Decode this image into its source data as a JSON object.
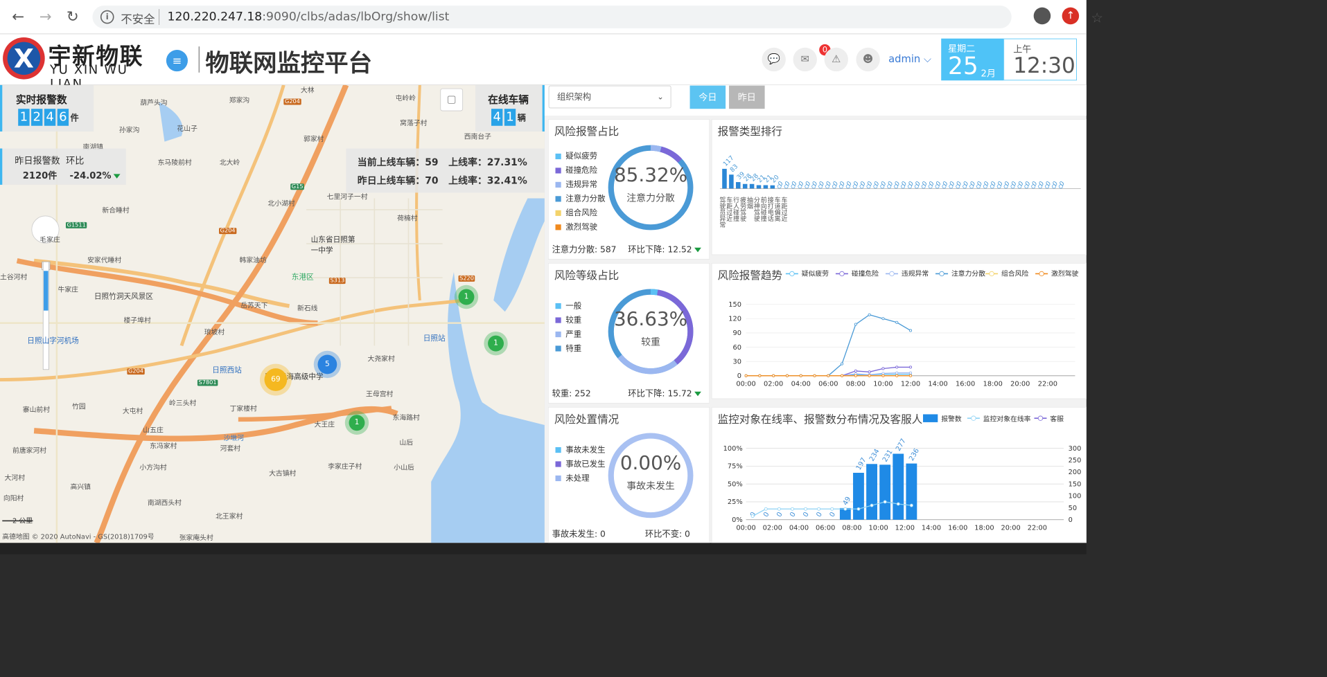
{
  "browser": {
    "insecure_label": "不安全",
    "host": "120.220.247.18",
    "path": ":9090/clbs/adas/lbOrg/show/list",
    "back": "←",
    "forward": "→",
    "reload": "↻",
    "info": "i",
    "star": "☆",
    "update": "↑"
  },
  "header": {
    "logo_cn": "宇新物联",
    "logo_en": "YU XIN WU LIAN",
    "logo_mark": "X",
    "system_title": "物联网监控平台",
    "menu_icon": "≡",
    "notification_count": "0",
    "user": "admin ⌵",
    "date": {
      "weekday": "星期二",
      "day": "25",
      "month": "2月"
    },
    "time": {
      "ampm": "上午",
      "clock": "12:30"
    }
  },
  "map": {
    "realtime_title": "实时报警数",
    "realtime_digits": [
      "1",
      "2",
      "4",
      "6"
    ],
    "realtime_unit": "件",
    "online_title": "在线车辆",
    "online_digits": [
      "4",
      "1"
    ],
    "online_unit": "辆",
    "yesterday_label": "昨日报警数",
    "ratio_label": "环比",
    "yesterday_value": "2120件",
    "ratio_value": "-24.02%",
    "current_online": "当前上线车辆：59",
    "current_rate": "上线率：27.31%",
    "yesterday_online": "昨日上线车辆：70",
    "yesterday_rate": "上线率：32.41%",
    "places": [
      "葫芦头沟",
      "郑家沟",
      "大林",
      "屯岭岭",
      "窝落子村",
      "西南台子",
      "孙家沟",
      "花山子",
      "郭家村",
      "南湖镇",
      "东马陵前村",
      "北大岭",
      "七里河子一村",
      "北小湖村",
      "荷楠村",
      "新合睡村",
      "毛家庄",
      "安家代睡村",
      "韩家油坊",
      "山东省日照第一中学",
      "东港区",
      "土谷河村",
      "牛家庄",
      "日照竹洞天风景区",
      "岳苏天下",
      "新石线",
      "日照站",
      "楼子埠村",
      "琅坡村",
      "大尧家村",
      "日照山字河机场",
      "日照西站",
      "日照黄海高级中学",
      "王母宫村",
      "竹园",
      "岭三头村",
      "丁家楼村",
      "大屯村",
      "寨山前村",
      "东冯家村",
      "山五庄",
      "沙墩河",
      "大王庄",
      "东海路村",
      "山后",
      "前唐家河村",
      "河套村",
      "小方沟村",
      "李家庄子村",
      "小山后",
      "大河村",
      "高兴镇",
      "大古镇村",
      "向阳村",
      "南湖西头村",
      "北王家村",
      "张家庵头村"
    ],
    "road_tags": [
      "G204",
      "G15",
      "S313",
      "S220",
      "G1511",
      "S7801",
      "G204",
      "G204"
    ],
    "clusters": [
      {
        "label": "69"
      },
      {
        "label": "5"
      },
      {
        "label": "1"
      },
      {
        "label": "1"
      },
      {
        "label": "1"
      }
    ],
    "scale": "2 公里",
    "attribution": "高德地图 © 2020 AutoNavi - GS(2018)1709号"
  },
  "toolbar": {
    "org_select": "组织架构",
    "today": "今日",
    "yesterday": "昨日"
  },
  "risk_share": {
    "title": "风险报警占比",
    "legend": [
      {
        "label": "疑似疲劳",
        "color": "#5bc0f4"
      },
      {
        "label": "碰撞危险",
        "color": "#7b68d8"
      },
      {
        "label": "违规异常",
        "color": "#9bb7f0"
      },
      {
        "label": "注意力分散",
        "color": "#4a9ad6"
      },
      {
        "label": "组合风险",
        "color": "#f3d36b"
      },
      {
        "label": "激烈驾驶",
        "color": "#f08a1e"
      }
    ],
    "percent": "85.32%",
    "center_label": "注意力分散",
    "footer_left": "注意力分散: 587",
    "footer_right": "环比下降: 12.52"
  },
  "risk_level": {
    "title": "风险等级占比",
    "legend": [
      {
        "label": "一般",
        "color": "#5bc0f4"
      },
      {
        "label": "较重",
        "color": "#7b68d8"
      },
      {
        "label": "严重",
        "color": "#9bb7f0"
      },
      {
        "label": "特重",
        "color": "#4a9ad6"
      }
    ],
    "percent": "36.63%",
    "center_label": "较重",
    "footer_left": "较重: 252",
    "footer_right": "环比下降: 15.72"
  },
  "disposal": {
    "title": "风险处置情况",
    "legend": [
      {
        "label": "事故未发生",
        "color": "#5bc0f4"
      },
      {
        "label": "事故已发生",
        "color": "#7b68d8"
      },
      {
        "label": "未处理",
        "color": "#9bb7f0"
      }
    ],
    "percent": "0.00%",
    "center_label": "事故未发生",
    "footer_left": "事故未发生: 0",
    "footer_right": "环比不变: 0"
  },
  "chart_data": [
    {
      "type": "bar",
      "title": "报警类型排行",
      "categories": [
        "驾驶员异常",
        "车距过近",
        "行人碰撞",
        "疲劳驾驶",
        "抽烟",
        "分神驾驶",
        "前向碰撞",
        "接打电话",
        "车道偏离",
        "车距过近"
      ],
      "values": [
        117,
        83,
        39,
        28,
        28,
        21,
        21,
        20,
        0,
        0
      ],
      "note": "remaining ~40 categories show 0"
    },
    {
      "type": "line",
      "title": "风险报警趋势",
      "x": [
        "00:00",
        "01:00",
        "02:00",
        "03:00",
        "04:00",
        "05:00",
        "06:00",
        "07:00",
        "08:00",
        "09:00",
        "10:00",
        "11:00",
        "12:00"
      ],
      "ylim": [
        0,
        150
      ],
      "yticks": [
        0,
        30,
        60,
        90,
        120,
        150
      ],
      "xticks": [
        "00:00",
        "02:00",
        "04:00",
        "06:00",
        "08:00",
        "10:00",
        "12:00",
        "14:00",
        "16:00",
        "18:00",
        "20:00",
        "22:00"
      ],
      "series": [
        {
          "name": "疑似疲劳",
          "color": "#5bc0f4",
          "values": [
            0,
            0,
            0,
            0,
            0,
            0,
            0,
            0,
            2,
            2,
            3,
            3,
            3
          ]
        },
        {
          "name": "碰撞危险",
          "color": "#7b68d8",
          "values": [
            0,
            0,
            0,
            0,
            0,
            0,
            0,
            0,
            10,
            8,
            15,
            18,
            18
          ]
        },
        {
          "name": "违规异常",
          "color": "#9bb7f0",
          "values": [
            0,
            0,
            0,
            0,
            0,
            0,
            0,
            0,
            4,
            2,
            5,
            6,
            6
          ]
        },
        {
          "name": "注意力分散",
          "color": "#4a9ad6",
          "values": [
            0,
            0,
            0,
            0,
            0,
            0,
            0,
            25,
            108,
            128,
            120,
            112,
            95
          ]
        },
        {
          "name": "组合风险",
          "color": "#f3d36b",
          "values": [
            0,
            0,
            0,
            0,
            0,
            0,
            0,
            0,
            0,
            0,
            0,
            0,
            0
          ]
        },
        {
          "name": "激烈驾驶",
          "color": "#f08a1e",
          "values": [
            0,
            0,
            0,
            0,
            0,
            0,
            0,
            0,
            0,
            0,
            0,
            0,
            0
          ]
        }
      ]
    },
    {
      "type": "bar",
      "title": "监控对象在线率、报警数分布情况及客服人员",
      "legend": [
        "报警数",
        "监控对象在线率",
        "客服"
      ],
      "x": [
        "00:00",
        "01:00",
        "02:00",
        "03:00",
        "04:00",
        "05:00",
        "06:00",
        "07:00",
        "08:00",
        "09:00",
        "10:00",
        "11:00",
        "12:00"
      ],
      "alarm_values": [
        0,
        0,
        0,
        0,
        0,
        0,
        0,
        49,
        197,
        234,
        231,
        277,
        236
      ],
      "online_rate": [
        5,
        15,
        15,
        15,
        15,
        15,
        15,
        15,
        15,
        20,
        25,
        22,
        20
      ],
      "left_ticks": [
        "0%",
        "25%",
        "50%",
        "75%",
        "100%"
      ],
      "right_ticks": [
        "0",
        "50",
        "100",
        "150",
        "200",
        "250",
        "300"
      ],
      "xticks": [
        "00:00",
        "02:00",
        "04:00",
        "06:00",
        "08:00",
        "10:00",
        "12:00",
        "14:00",
        "16:00",
        "18:00",
        "20:00",
        "22:00"
      ]
    }
  ]
}
